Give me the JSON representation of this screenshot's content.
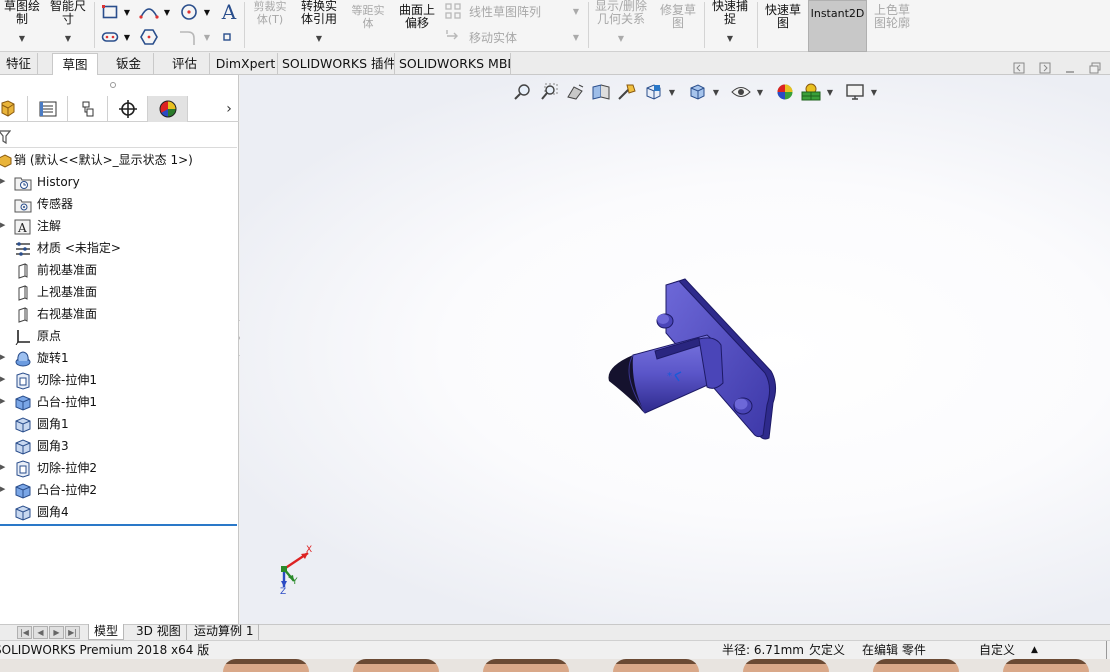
{
  "ribbon": {
    "sketch_draw_label": "草图绘\n制",
    "smart_dim_label": "智能尺\n寸",
    "trim_label": "剪裁实\n体(T)",
    "convert_label": "转换实\n体引用",
    "offset_label": "等距实\n体",
    "surface_offset_label": "曲面上\n偏移",
    "linear_pattern_label": "线性草图阵列",
    "move_label": "移动实体",
    "show_relations_label": "显示/删除\n几何关系",
    "repair_label": "修复草\n图",
    "quick_snap_label": "快速捕\n捉",
    "rapid_sketch_label": "快速草\n图",
    "instant2d_label": "Instant2D",
    "shaded_label": "上色草\n图轮廓"
  },
  "tabs": [
    "特征",
    "草图",
    "钣金",
    "评估",
    "DimXpert",
    "SOLIDWORKS 插件",
    "SOLIDWORKS MBD"
  ],
  "active_tab": "草图",
  "tree": {
    "root": "销  (默认<<默认>_显示状态 1>)",
    "items": [
      "History",
      "传感器",
      "注解",
      "材质 <未指定>",
      "前视基准面",
      "上视基准面",
      "右视基准面",
      "原点",
      "旋转1",
      "切除-拉伸1",
      "凸台-拉伸1",
      "圆角1",
      "圆角3",
      "切除-拉伸2",
      "凸台-拉伸2",
      "圆角4"
    ]
  },
  "bottom_tabs": [
    "模型",
    "3D 视图",
    "运动算例 1"
  ],
  "status": {
    "app": "SOLIDWORKS Premium 2018 x64 版",
    "radius": "半径: 6.71mm",
    "defined": "欠定义",
    "editing": "在编辑 零件",
    "custom": "自定义"
  },
  "triad": {
    "x": "X",
    "y": "Y",
    "z": "Z"
  },
  "colors": {
    "part": "#5a55c8",
    "part_dark": "#2e2a8c",
    "accent": "#2a78c8"
  }
}
